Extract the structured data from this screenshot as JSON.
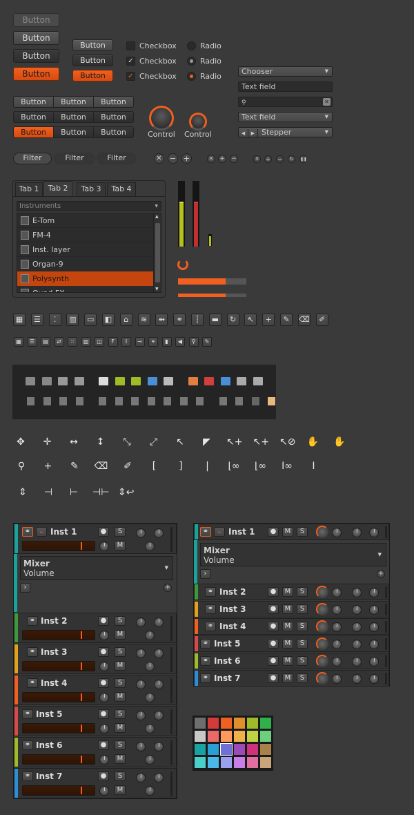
{
  "buttons": {
    "label": "Button"
  },
  "checks": {
    "label": "Checkbox",
    "radio": "Radio"
  },
  "chooser": "Chooser",
  "textfield": "Text field",
  "textfield2": "Text field",
  "stepper": "Stepper",
  "control": "Control",
  "filters": [
    "Filter",
    "Filter",
    "Filter"
  ],
  "tabs": [
    "Tab 1",
    "Tab 2",
    "Tab 3",
    "Tab 4"
  ],
  "browser": {
    "placeholder": "Instruments",
    "items": [
      "E-Tom",
      "FM-4",
      "Inst. layer",
      "Organ-9",
      "Polysynth",
      "Quad FX"
    ],
    "selected": 4
  },
  "progress": {
    "p1": 0.7,
    "p2": 0.7
  },
  "meters": {
    "l1": 0.68,
    "l2": 0.68
  },
  "palette": [
    "#6e6e6e",
    "#d43a3a",
    "#f06020",
    "#e0902a",
    "#9fbb28",
    "#2eb14a",
    "#c8c8c8",
    "#ea6a6a",
    "#ff9a5a",
    "#f0b04a",
    "#bfd244",
    "#6ccf7e",
    "#19a2a2",
    "#2a9fd6",
    "#6f6fd8",
    "#9b4ab8",
    "#d0327a",
    "#a8824a",
    "#4ad0c8",
    "#4ab8e8",
    "#9aa0f0",
    "#c880e8",
    "#e070a0",
    "#c8a47a"
  ],
  "mixer": {
    "inst1": "Inst 1",
    "m_title": "Mixer",
    "m_sub": "Volume",
    "insts": [
      "Inst 2",
      "Inst 3",
      "Inst 4",
      "Inst 5",
      "Inst 6",
      "Inst 7"
    ],
    "colors": [
      "#3c9a3c",
      "#e0a020",
      "#f06020",
      "#d84a4a",
      "#9fbb28",
      "#2a8fd6"
    ],
    "s": "S",
    "m": "M"
  }
}
